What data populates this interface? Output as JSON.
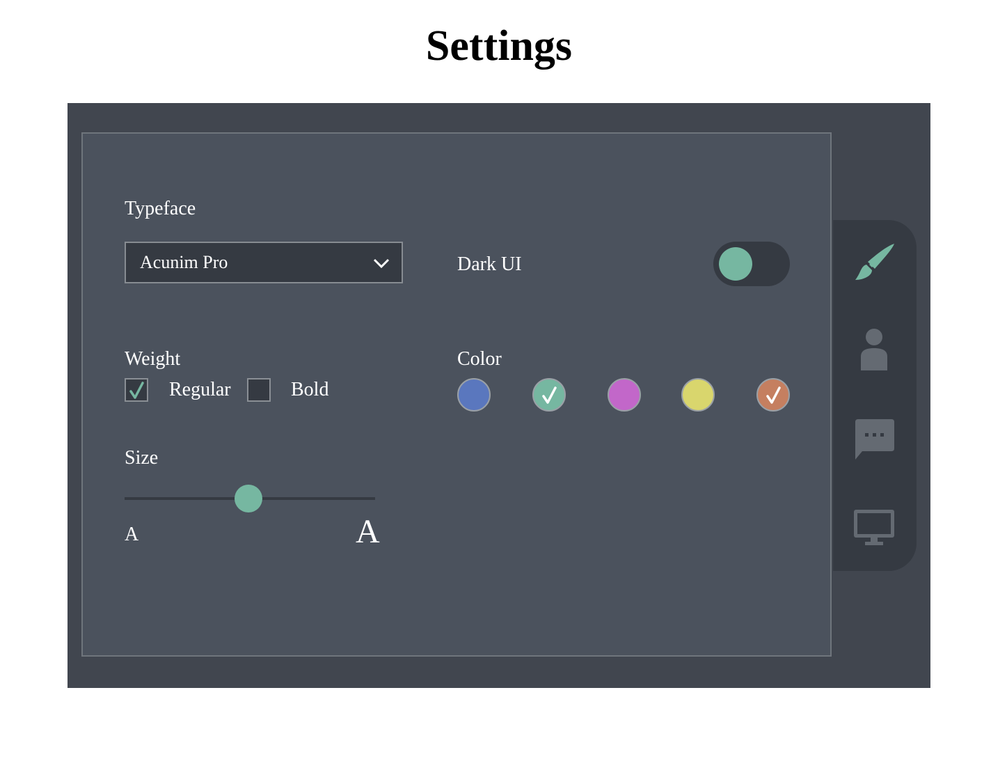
{
  "page": {
    "title": "Settings"
  },
  "colors": {
    "accent": "#76b7a1",
    "panel_bg": "#4b525d",
    "frame_bg": "#41464f",
    "control_bg": "#353a42",
    "inactive_icon": "#646a72"
  },
  "typeface": {
    "label": "Typeface",
    "selected": "Acunim Pro",
    "icon": "chevron-down-icon"
  },
  "dark_ui": {
    "label": "Dark UI",
    "enabled": true
  },
  "weight": {
    "label": "Weight",
    "options": [
      {
        "label": "Regular",
        "checked": true
      },
      {
        "label": "Bold",
        "checked": false
      }
    ]
  },
  "color": {
    "label": "Color",
    "swatches": [
      {
        "color": "#5a77be",
        "checked": false
      },
      {
        "color": "#76b7a1",
        "checked": true
      },
      {
        "color": "#c267c9",
        "checked": false
      },
      {
        "color": "#d9d66d",
        "checked": false
      },
      {
        "color": "#c57f60",
        "checked": true
      }
    ]
  },
  "size": {
    "label": "Size",
    "min_label": "A",
    "max_label": "A",
    "value_fraction": 0.5
  },
  "tabs": [
    {
      "icon": "paintbrush-icon",
      "active": true
    },
    {
      "icon": "user-icon",
      "active": false
    },
    {
      "icon": "chat-bubble-icon",
      "active": false
    },
    {
      "icon": "monitor-icon",
      "active": false
    }
  ]
}
